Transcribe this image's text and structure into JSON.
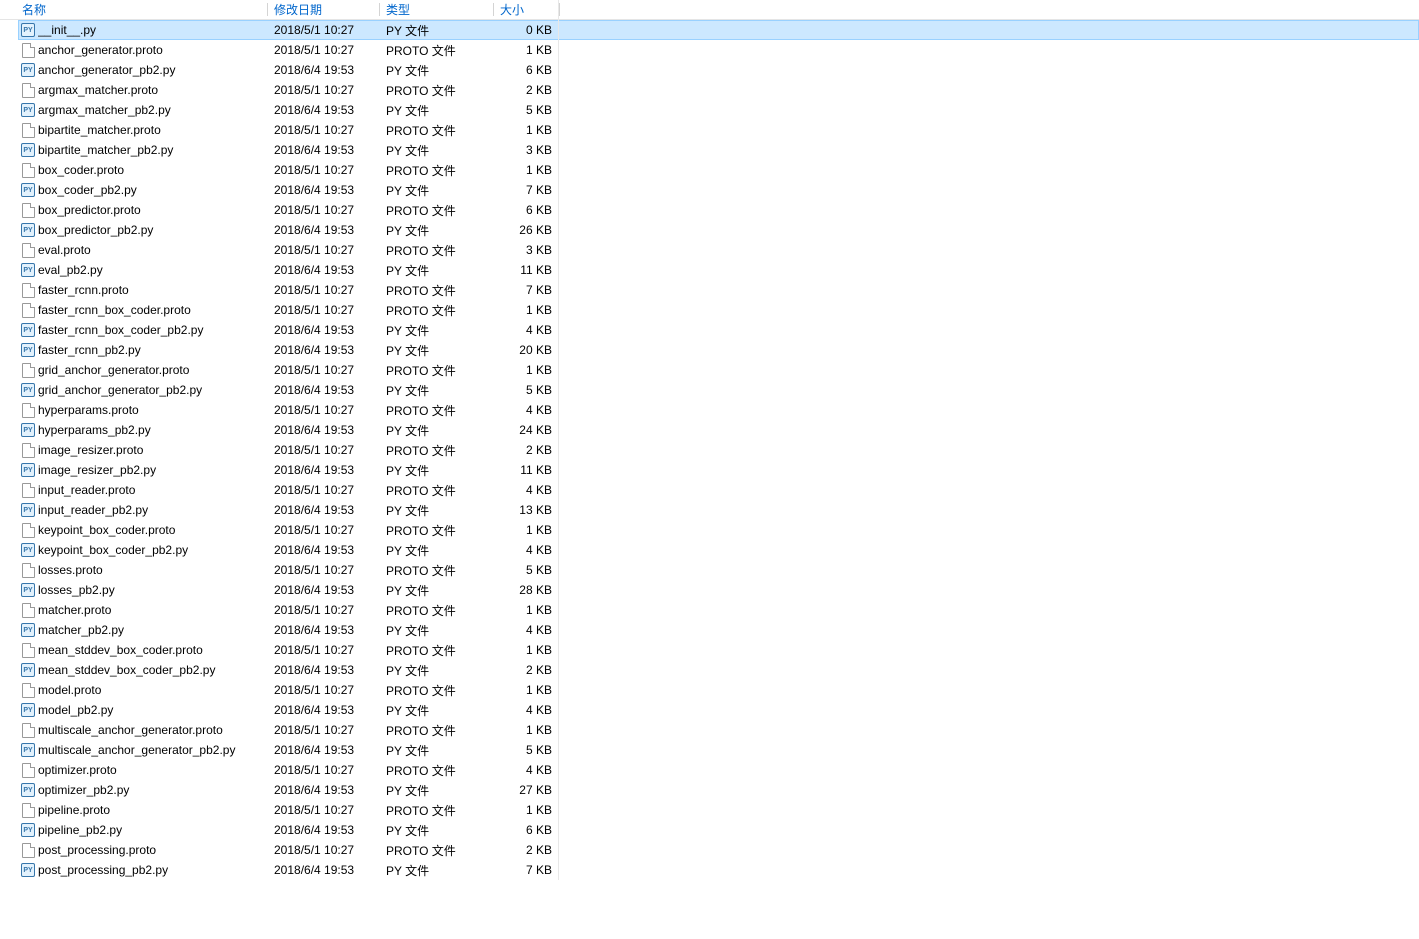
{
  "columns": {
    "name": "名称",
    "date": "修改日期",
    "type": "类型",
    "size": "大小"
  },
  "files": [
    {
      "name": "__init__.py",
      "date": "2018/5/1 10:27",
      "type": "PY 文件",
      "size": "0 KB",
      "icon": "py",
      "selected": true
    },
    {
      "name": "anchor_generator.proto",
      "date": "2018/5/1 10:27",
      "type": "PROTO 文件",
      "size": "1 KB",
      "icon": "proto"
    },
    {
      "name": "anchor_generator_pb2.py",
      "date": "2018/6/4 19:53",
      "type": "PY 文件",
      "size": "6 KB",
      "icon": "py"
    },
    {
      "name": "argmax_matcher.proto",
      "date": "2018/5/1 10:27",
      "type": "PROTO 文件",
      "size": "2 KB",
      "icon": "proto"
    },
    {
      "name": "argmax_matcher_pb2.py",
      "date": "2018/6/4 19:53",
      "type": "PY 文件",
      "size": "5 KB",
      "icon": "py"
    },
    {
      "name": "bipartite_matcher.proto",
      "date": "2018/5/1 10:27",
      "type": "PROTO 文件",
      "size": "1 KB",
      "icon": "proto"
    },
    {
      "name": "bipartite_matcher_pb2.py",
      "date": "2018/6/4 19:53",
      "type": "PY 文件",
      "size": "3 KB",
      "icon": "py"
    },
    {
      "name": "box_coder.proto",
      "date": "2018/5/1 10:27",
      "type": "PROTO 文件",
      "size": "1 KB",
      "icon": "proto"
    },
    {
      "name": "box_coder_pb2.py",
      "date": "2018/6/4 19:53",
      "type": "PY 文件",
      "size": "7 KB",
      "icon": "py"
    },
    {
      "name": "box_predictor.proto",
      "date": "2018/5/1 10:27",
      "type": "PROTO 文件",
      "size": "6 KB",
      "icon": "proto"
    },
    {
      "name": "box_predictor_pb2.py",
      "date": "2018/6/4 19:53",
      "type": "PY 文件",
      "size": "26 KB",
      "icon": "py"
    },
    {
      "name": "eval.proto",
      "date": "2018/5/1 10:27",
      "type": "PROTO 文件",
      "size": "3 KB",
      "icon": "proto"
    },
    {
      "name": "eval_pb2.py",
      "date": "2018/6/4 19:53",
      "type": "PY 文件",
      "size": "11 KB",
      "icon": "py"
    },
    {
      "name": "faster_rcnn.proto",
      "date": "2018/5/1 10:27",
      "type": "PROTO 文件",
      "size": "7 KB",
      "icon": "proto"
    },
    {
      "name": "faster_rcnn_box_coder.proto",
      "date": "2018/5/1 10:27",
      "type": "PROTO 文件",
      "size": "1 KB",
      "icon": "proto"
    },
    {
      "name": "faster_rcnn_box_coder_pb2.py",
      "date": "2018/6/4 19:53",
      "type": "PY 文件",
      "size": "4 KB",
      "icon": "py"
    },
    {
      "name": "faster_rcnn_pb2.py",
      "date": "2018/6/4 19:53",
      "type": "PY 文件",
      "size": "20 KB",
      "icon": "py"
    },
    {
      "name": "grid_anchor_generator.proto",
      "date": "2018/5/1 10:27",
      "type": "PROTO 文件",
      "size": "1 KB",
      "icon": "proto"
    },
    {
      "name": "grid_anchor_generator_pb2.py",
      "date": "2018/6/4 19:53",
      "type": "PY 文件",
      "size": "5 KB",
      "icon": "py"
    },
    {
      "name": "hyperparams.proto",
      "date": "2018/5/1 10:27",
      "type": "PROTO 文件",
      "size": "4 KB",
      "icon": "proto"
    },
    {
      "name": "hyperparams_pb2.py",
      "date": "2018/6/4 19:53",
      "type": "PY 文件",
      "size": "24 KB",
      "icon": "py"
    },
    {
      "name": "image_resizer.proto",
      "date": "2018/5/1 10:27",
      "type": "PROTO 文件",
      "size": "2 KB",
      "icon": "proto"
    },
    {
      "name": "image_resizer_pb2.py",
      "date": "2018/6/4 19:53",
      "type": "PY 文件",
      "size": "11 KB",
      "icon": "py"
    },
    {
      "name": "input_reader.proto",
      "date": "2018/5/1 10:27",
      "type": "PROTO 文件",
      "size": "4 KB",
      "icon": "proto"
    },
    {
      "name": "input_reader_pb2.py",
      "date": "2018/6/4 19:53",
      "type": "PY 文件",
      "size": "13 KB",
      "icon": "py"
    },
    {
      "name": "keypoint_box_coder.proto",
      "date": "2018/5/1 10:27",
      "type": "PROTO 文件",
      "size": "1 KB",
      "icon": "proto"
    },
    {
      "name": "keypoint_box_coder_pb2.py",
      "date": "2018/6/4 19:53",
      "type": "PY 文件",
      "size": "4 KB",
      "icon": "py"
    },
    {
      "name": "losses.proto",
      "date": "2018/5/1 10:27",
      "type": "PROTO 文件",
      "size": "5 KB",
      "icon": "proto"
    },
    {
      "name": "losses_pb2.py",
      "date": "2018/6/4 19:53",
      "type": "PY 文件",
      "size": "28 KB",
      "icon": "py"
    },
    {
      "name": "matcher.proto",
      "date": "2018/5/1 10:27",
      "type": "PROTO 文件",
      "size": "1 KB",
      "icon": "proto"
    },
    {
      "name": "matcher_pb2.py",
      "date": "2018/6/4 19:53",
      "type": "PY 文件",
      "size": "4 KB",
      "icon": "py"
    },
    {
      "name": "mean_stddev_box_coder.proto",
      "date": "2018/5/1 10:27",
      "type": "PROTO 文件",
      "size": "1 KB",
      "icon": "proto"
    },
    {
      "name": "mean_stddev_box_coder_pb2.py",
      "date": "2018/6/4 19:53",
      "type": "PY 文件",
      "size": "2 KB",
      "icon": "py"
    },
    {
      "name": "model.proto",
      "date": "2018/5/1 10:27",
      "type": "PROTO 文件",
      "size": "1 KB",
      "icon": "proto"
    },
    {
      "name": "model_pb2.py",
      "date": "2018/6/4 19:53",
      "type": "PY 文件",
      "size": "4 KB",
      "icon": "py"
    },
    {
      "name": "multiscale_anchor_generator.proto",
      "date": "2018/5/1 10:27",
      "type": "PROTO 文件",
      "size": "1 KB",
      "icon": "proto"
    },
    {
      "name": "multiscale_anchor_generator_pb2.py",
      "date": "2018/6/4 19:53",
      "type": "PY 文件",
      "size": "5 KB",
      "icon": "py"
    },
    {
      "name": "optimizer.proto",
      "date": "2018/5/1 10:27",
      "type": "PROTO 文件",
      "size": "4 KB",
      "icon": "proto"
    },
    {
      "name": "optimizer_pb2.py",
      "date": "2018/6/4 19:53",
      "type": "PY 文件",
      "size": "27 KB",
      "icon": "py"
    },
    {
      "name": "pipeline.proto",
      "date": "2018/5/1 10:27",
      "type": "PROTO 文件",
      "size": "1 KB",
      "icon": "proto"
    },
    {
      "name": "pipeline_pb2.py",
      "date": "2018/6/4 19:53",
      "type": "PY 文件",
      "size": "6 KB",
      "icon": "py"
    },
    {
      "name": "post_processing.proto",
      "date": "2018/5/1 10:27",
      "type": "PROTO 文件",
      "size": "2 KB",
      "icon": "proto"
    },
    {
      "name": "post_processing_pb2.py",
      "date": "2018/6/4 19:53",
      "type": "PY 文件",
      "size": "7 KB",
      "icon": "py"
    }
  ]
}
